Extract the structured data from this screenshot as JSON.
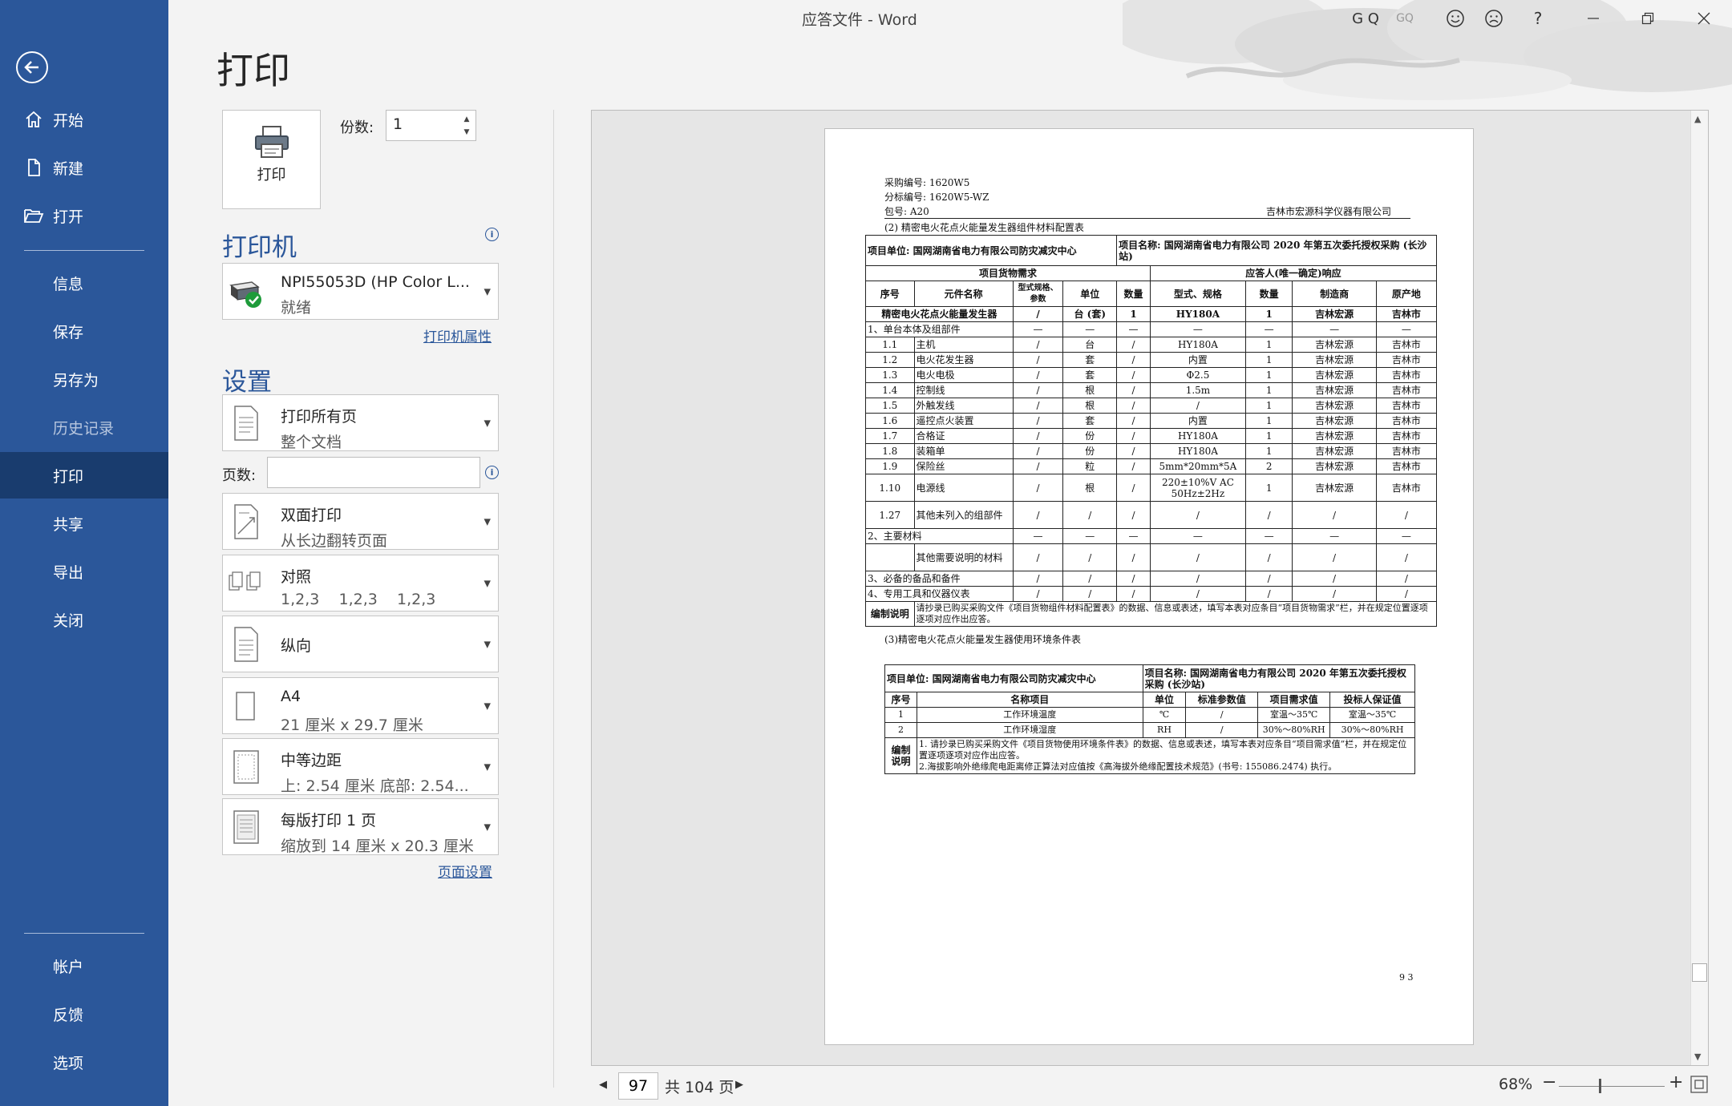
{
  "window": {
    "title": "应答文件 - Word",
    "user_initials": "G Q",
    "user_badge": "GQ",
    "help_label": "?"
  },
  "nav": {
    "back_label": "返回",
    "items_top": [
      {
        "label": "开始",
        "icon": "home-icon"
      },
      {
        "label": "新建",
        "icon": "new-document-icon"
      },
      {
        "label": "打开",
        "icon": "open-folder-icon"
      }
    ],
    "items_mid": [
      "信息",
      "保存",
      "另存为",
      "历史记录",
      "打印",
      "共享",
      "导出",
      "关闭"
    ],
    "active": "打印",
    "items_bottom": [
      "帐户",
      "反馈",
      "选项"
    ]
  },
  "print": {
    "page_title": "打印",
    "print_button": "打印",
    "copies_label": "份数:",
    "copies_value": "1",
    "printer_heading": "打印机",
    "printer_name": "NPI55053D (HP Color L...",
    "printer_status": "就绪",
    "printer_properties": "打印机属性",
    "settings_heading": "设置",
    "pages_label": "页数:",
    "pages_value": "",
    "page_setup": "页面设置",
    "settings": [
      {
        "name": "print-range",
        "t1": "打印所有页",
        "t2": "整个文档"
      },
      {
        "name": "duplex",
        "t1": "双面打印",
        "t2": "从长边翻转页面"
      },
      {
        "name": "collation",
        "t1": "对照",
        "t2": "1,2,3    1,2,3    1,2,3"
      },
      {
        "name": "orientation",
        "t1": "纵向",
        "t2": ""
      },
      {
        "name": "paper-size",
        "t1": "A4",
        "t2": "21 厘米 x 29.7 厘米"
      },
      {
        "name": "margins",
        "t1": "中等边距",
        "t2": "上: 2.54 厘米 底部: 2.54..."
      },
      {
        "name": "pages-per-sheet",
        "t1": "每版打印 1 页",
        "t2": "缩放到 14 厘米 x 20.3 厘米"
      }
    ]
  },
  "footer": {
    "current_page": "97",
    "total_pages": "共 104 页",
    "zoom": "68%",
    "zoom_level": 0.68
  },
  "doc": {
    "header": [
      "采购编号: 1620W5",
      "分标编号: 1620W5-WZ",
      "包号: A20"
    ],
    "company": "吉林市宏源科学仪器有限公司",
    "sec2_title": "(2) 精密电火花点火能量发生器组件材料配置表",
    "t1_unit": "项目单位: 国网湖南省电力有限公司防灾减灾中心",
    "t1_project": "项目名称: 国网湖南省电力有限公司 2020 年第五次委托授权采购 (长沙站)",
    "t1_head1": [
      "项目货物需求",
      "应答人(唯一确定)响应"
    ],
    "t1_head2": [
      "序号",
      "元件名称",
      "型式规格、参数",
      "单位",
      "数量",
      "型式、规格",
      "数量",
      "制造商",
      "原产地"
    ],
    "t1_rows": [
      [
        "精密电火花点火能量发生器",
        "/",
        "台 (套)",
        "1",
        "HY180A",
        "1",
        "吉林宏源",
        "吉林市"
      ],
      [
        "1、单台本体及组部件",
        "—",
        "—",
        "—",
        "—",
        "—",
        "—",
        "—"
      ],
      [
        "1.1",
        "主机",
        "/",
        "台",
        "/",
        "HY180A",
        "1",
        "吉林宏源",
        "吉林市"
      ],
      [
        "1.2",
        "电火花发生器",
        "/",
        "套",
        "/",
        "内置",
        "1",
        "吉林宏源",
        "吉林市"
      ],
      [
        "1.3",
        "电火电极",
        "/",
        "套",
        "/",
        "Φ2.5",
        "1",
        "吉林宏源",
        "吉林市"
      ],
      [
        "1.4",
        "控制线",
        "/",
        "根",
        "/",
        "1.5m",
        "1",
        "吉林宏源",
        "吉林市"
      ],
      [
        "1.5",
        "外触发线",
        "/",
        "根",
        "/",
        "/",
        "1",
        "吉林宏源",
        "吉林市"
      ],
      [
        "1.6",
        "遥控点火装置",
        "/",
        "套",
        "/",
        "内置",
        "1",
        "吉林宏源",
        "吉林市"
      ],
      [
        "1.7",
        "合格证",
        "/",
        "份",
        "/",
        "HY180A",
        "1",
        "吉林宏源",
        "吉林市"
      ],
      [
        "1.8",
        "装箱单",
        "/",
        "份",
        "/",
        "HY180A",
        "1",
        "吉林宏源",
        "吉林市"
      ],
      [
        "1.9",
        "保险丝",
        "/",
        "粒",
        "/",
        "5mm*20mm*5A",
        "2",
        "吉林宏源",
        "吉林市"
      ],
      [
        "1.10",
        "电源线",
        "/",
        "根",
        "/",
        "220±10%V AC 50Hz±2Hz",
        "1",
        "吉林宏源",
        "吉林市"
      ],
      [
        "1.27",
        "其他未列入的组部件",
        "/",
        "/",
        "/",
        "/",
        "/",
        "/",
        "/"
      ],
      [
        "2、主要材料",
        "—",
        "—",
        "—",
        "—",
        "—",
        "—",
        "—"
      ],
      [
        "",
        "其他需要说明的材料",
        "/",
        "/",
        "/",
        "/",
        "/",
        "/",
        "/"
      ],
      [
        "3、必备的备品和备件",
        "/",
        "/",
        "/",
        "/",
        "/",
        "/",
        "/"
      ],
      [
        "4、专用工具和仪器仪表",
        "/",
        "/",
        "/",
        "/",
        "/",
        "/",
        "/"
      ]
    ],
    "t1_note_label": "编制说明",
    "t1_note": "请抄录已购买采购文件《项目货物组件材料配置表》的数据、信息或表述，填写本表对应条目“项目货物需求”栏，并在规定位置逐项逐项对应作出应答。",
    "sec3_title": "(3)精密电火花点火能量发生器使用环境条件表",
    "t2_unit": "项目单位: 国网湖南省电力有限公司防灾减灾中心",
    "t2_project": "项目名称: 国网湖南省电力有限公司 2020 年第五次委托授权采购 (长沙站)",
    "t2_head": [
      "序号",
      "名称项目",
      "单位",
      "标准参数值",
      "项目需求值",
      "投标人保证值"
    ],
    "t2_rows": [
      [
        "1",
        "工作环境温度",
        "℃",
        "/",
        "室温～35℃",
        "室温～35℃"
      ],
      [
        "2",
        "工作环境湿度",
        "RH",
        "/",
        "30%～80%RH",
        "30%～80%RH"
      ]
    ],
    "t2_note_label": "编制说明",
    "t2_note1": "1. 请抄录已购买采购文件《项目货物使用环境条件表》的数据、信息或表述，填写本表对应条目“项目需求值”栏，并在规定位置逐项逐项对应作出应答。",
    "t2_note2": "2.海拔影响外绝缘爬电距离修正算法对应值按《高海拔外绝缘配置技术规范》(书号: 155086.2474) 执行。",
    "page_no": "9 3"
  }
}
